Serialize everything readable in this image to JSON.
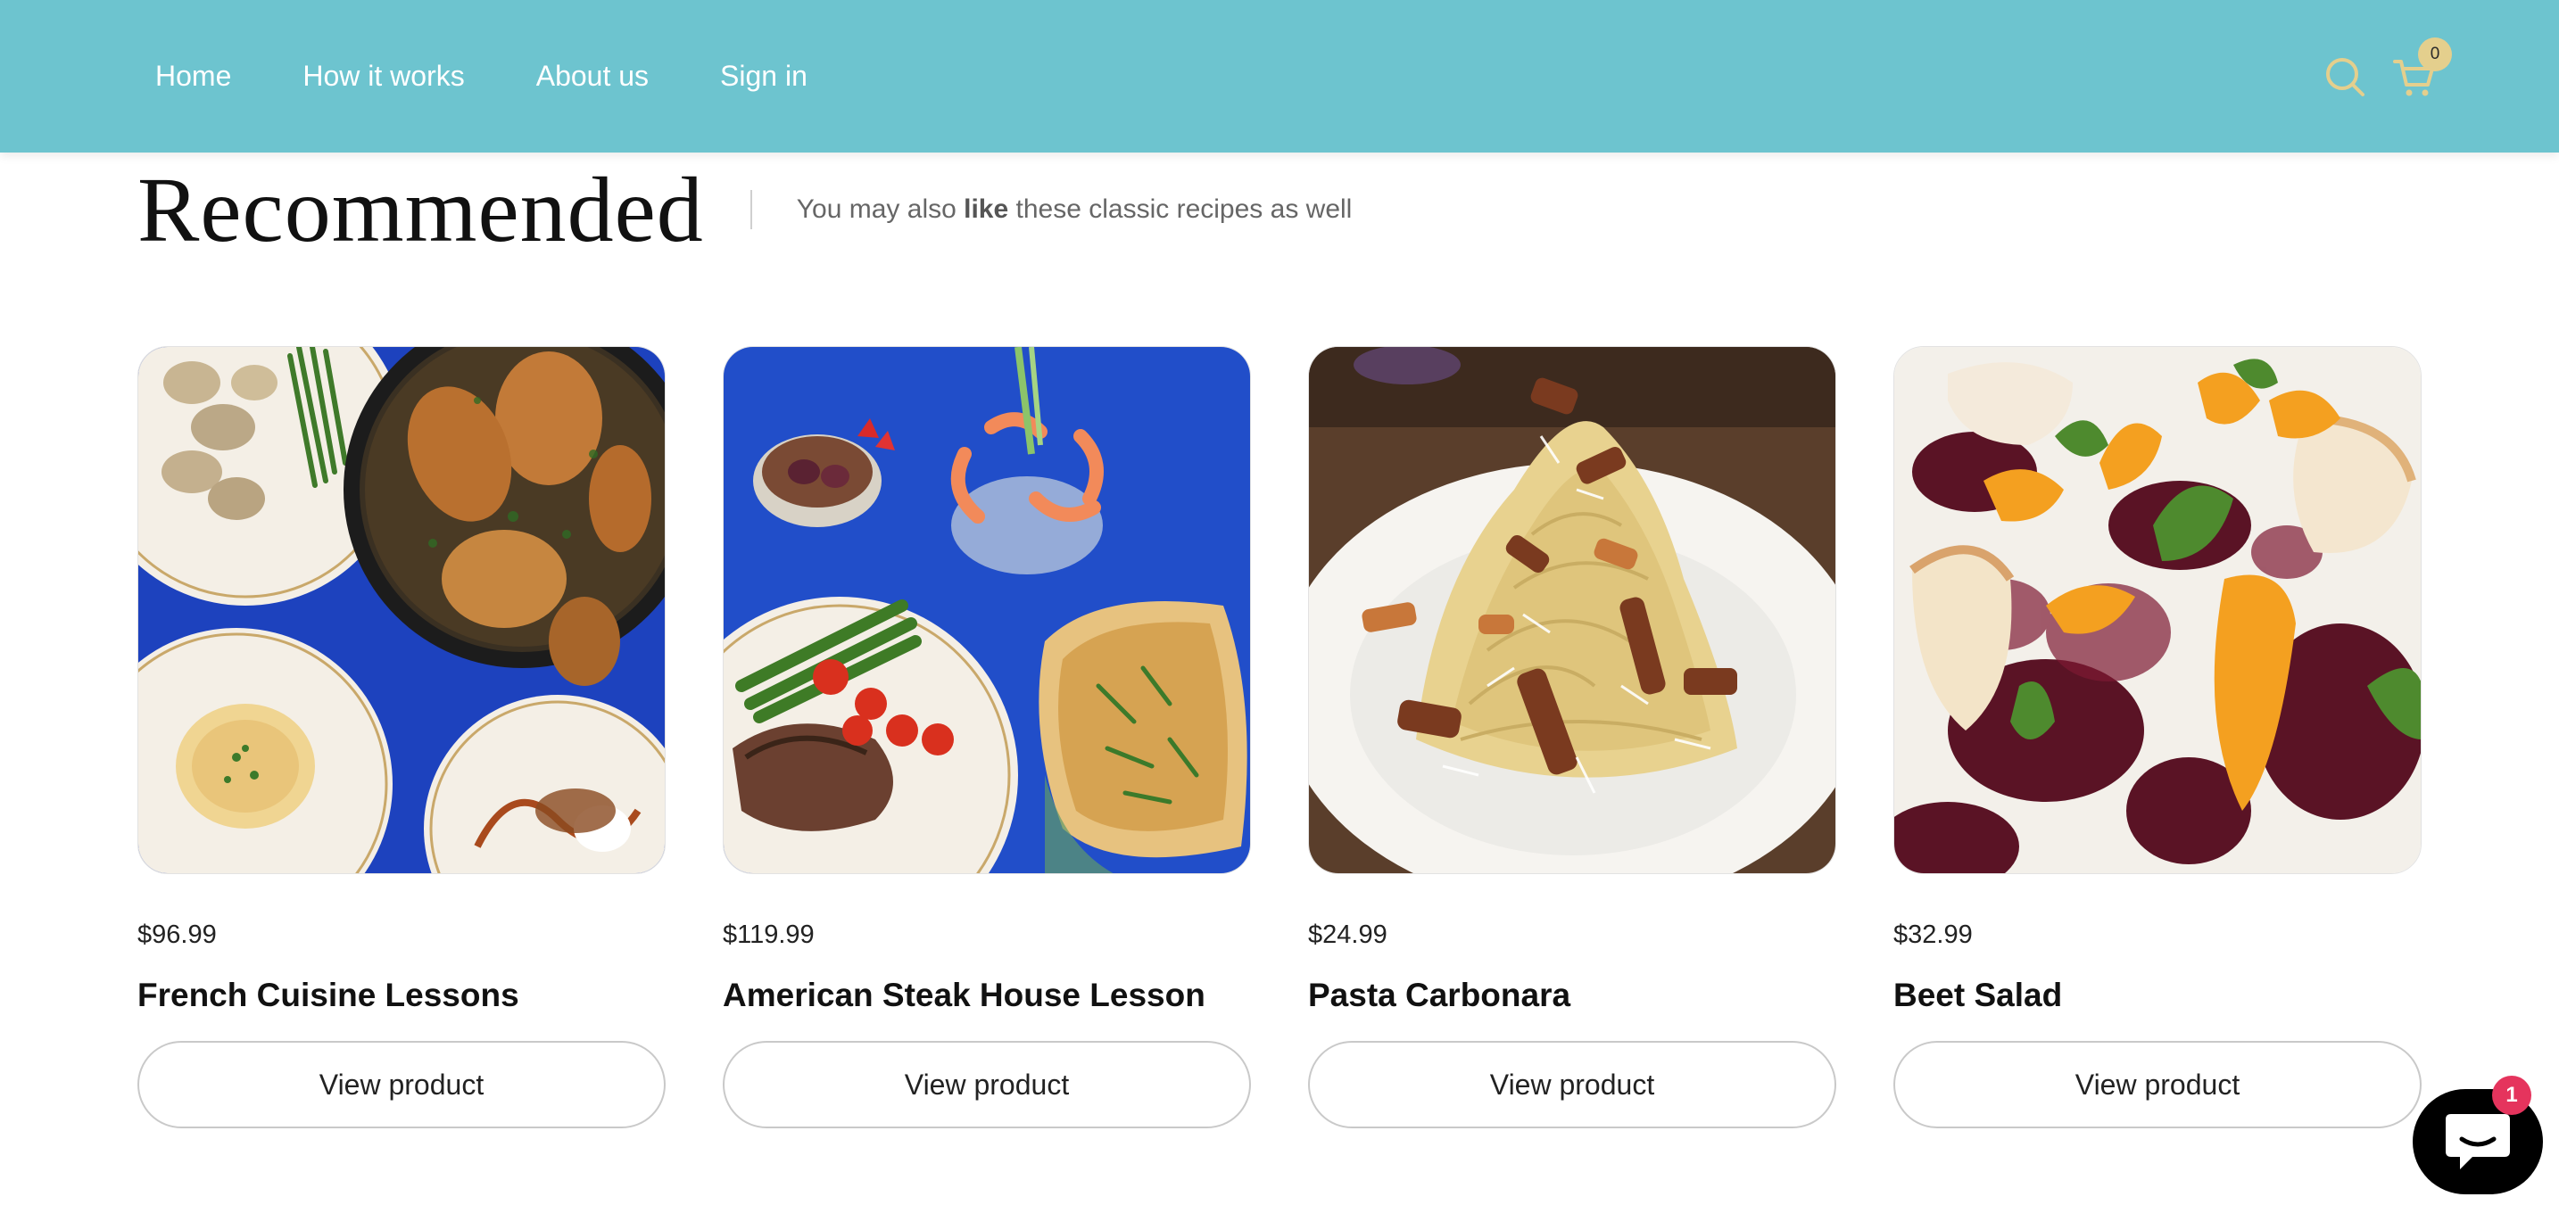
{
  "header": {
    "nav": [
      {
        "label": "Home"
      },
      {
        "label": "How it works"
      },
      {
        "label": "About us"
      },
      {
        "label": "Sign in"
      }
    ],
    "search_icon": "search-icon",
    "cart_icon": "cart-icon",
    "cart_count": "0",
    "colors": {
      "bar": "#6dc4cf",
      "icons": "#e4cf8d"
    }
  },
  "section": {
    "title": "Recommended",
    "subtitle_pre": "You may also ",
    "subtitle_bold": "like",
    "subtitle_post": " these classic recipes as well"
  },
  "products": [
    {
      "price": "$96.99",
      "title": "French Cuisine Lessons",
      "button": "View product",
      "image": "roast chicken in skillet, potatoes, green beans, gratin on blue cloth"
    },
    {
      "price": "$119.99",
      "title": "American Steak House Lesson",
      "button": "View product",
      "image": "steak with asparagus and tomatoes, shrimp cocktail, dessert, casserole on blue cloth"
    },
    {
      "price": "$24.99",
      "title": "Pasta Carbonara",
      "button": "View product",
      "image": "spaghetti carbonara with bacon and grated cheese"
    },
    {
      "price": "$32.99",
      "title": "Beet Salad",
      "button": "View product",
      "image": "beets, orange slices, arugula and brie"
    }
  ],
  "chat": {
    "icon": "chat-icon",
    "badge": "1",
    "badge_color": "#e5345d"
  }
}
